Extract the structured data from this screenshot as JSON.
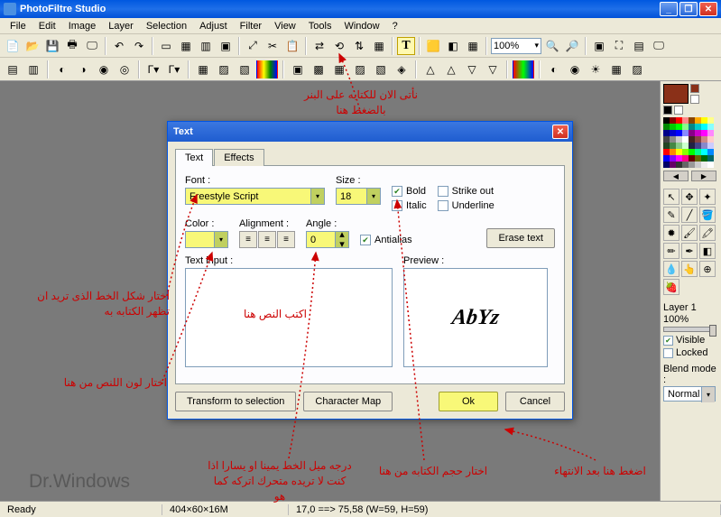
{
  "app": {
    "title": "PhotoFiltre Studio"
  },
  "menu": [
    "File",
    "Edit",
    "Image",
    "Layer",
    "Selection",
    "Adjust",
    "Filter",
    "View",
    "Tools",
    "Window",
    "?"
  ],
  "zoom": "100%",
  "dialog": {
    "title": "Text",
    "tabs": [
      "Text",
      "Effects"
    ],
    "font_label": "Font :",
    "font_value": "Freestyle Script",
    "size_label": "Size :",
    "size_value": "18",
    "bold": "Bold",
    "italic": "Italic",
    "strikeout": "Strike out",
    "underline": "Underline",
    "color_label": "Color :",
    "alignment_label": "Alignment :",
    "angle_label": "Angle :",
    "angle_value": "0",
    "antialias": "Antialias",
    "erase": "Erase text",
    "text_input_label": "Text input :",
    "preview_label": "Preview :",
    "preview_text": "AbYz",
    "transform": "Transform to selection",
    "charmap": "Character Map",
    "ok": "Ok",
    "cancel": "Cancel"
  },
  "palette": {
    "layer": "Layer 1",
    "opacity": "100%",
    "visible": "Visible",
    "locked": "Locked",
    "blend_label": "Blend mode :",
    "blend_value": "Normal"
  },
  "status": {
    "ready": "Ready",
    "dims": "404×60×16M",
    "coords": "17,0 ==> 75,58 (W=59, H=59)"
  },
  "annotations": {
    "a1": "نأتى الان للكتابه على البنر\nبالضغط هنا",
    "a2": "اختار شكل الخط الذى تريد ان\nتظهر الكتابه به",
    "a3": "اكتب النص هنا",
    "a4": "اختار لون اللنص من هنا",
    "a5": "درجه ميل الخط يمينا او يسارا\nاذا كنت لا تريده متحرك اتركه\nكما هو",
    "a6": "اختار حجم الكتابه من هنا",
    "a7": "اضغط هنا بعد الانتهاء",
    "watermark": "Dr.Windows"
  }
}
